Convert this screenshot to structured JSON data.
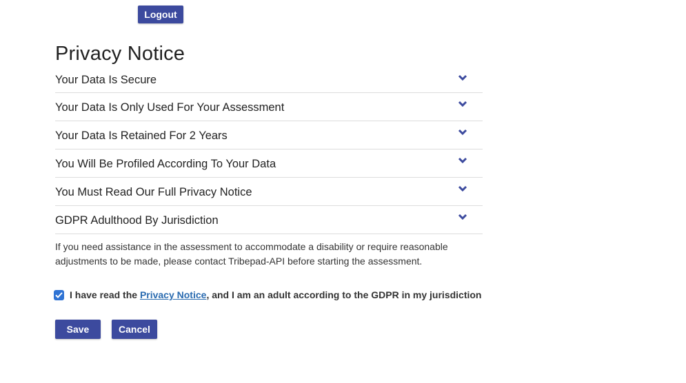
{
  "header": {
    "logout_label": "Logout"
  },
  "page_title": "Privacy Notice",
  "accordion": [
    {
      "title": "Your Data Is Secure"
    },
    {
      "title": "Your Data Is Only Used For Your Assessment"
    },
    {
      "title": "Your Data Is Retained For 2 Years"
    },
    {
      "title": "You Will Be Profiled According To Your Data"
    },
    {
      "title": "You Must Read Our Full Privacy Notice"
    },
    {
      "title": "GDPR Adulthood By Jurisdiction"
    }
  ],
  "assistance_text": "If you need assistance in the assessment to accommodate a disability or require reasonable adjustments to be made, please contact Tribepad-API before starting the assessment.",
  "consent": {
    "checked": true,
    "prefix": "I have read the ",
    "link_text": "Privacy Notice",
    "suffix": ", and I am an adult according to the GDPR in my jurisdiction"
  },
  "actions": {
    "save_label": "Save",
    "cancel_label": "Cancel"
  },
  "colors": {
    "button": "#3c4a9e",
    "link": "#2a6bb0",
    "checkbox": "#2f73d4",
    "chevron": "#3c4a9e"
  },
  "icons": {
    "chevron": "chevron-down-icon",
    "check": "checkmark-icon"
  }
}
